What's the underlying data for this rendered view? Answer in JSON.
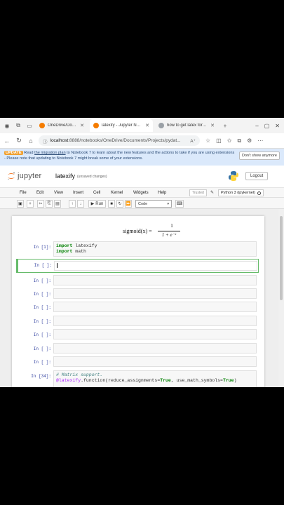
{
  "browser": {
    "tabs": [
      {
        "title": "OneDrive/Documents/P",
        "favicon_color": "#f57c00"
      },
      {
        "title": "latexify - Jupyter Notel",
        "favicon_color": "#f57c00",
        "active": true
      },
      {
        "title": "how to get latex formul",
        "favicon_color": "#5f6368"
      }
    ],
    "new_tab": "+",
    "window_controls": {
      "minimize": "–",
      "maximize": "▢",
      "close": "✕"
    },
    "address": {
      "host": "localhost",
      "rest": ":8888/notebooks/OneDrive/Documents/Projects/pydat...",
      "reader": "A",
      "zoom_label": "A⁺"
    }
  },
  "banner": {
    "badge": "UPDATE",
    "text_before": "Read ",
    "link": "the migration plan",
    "text_after": " to Notebook 7 to learn about the new features and the actions to take if you are using extensions - Please note that updating to Notebook 7 might break some of your extensions.",
    "dismiss": "Don't show anymore"
  },
  "header": {
    "logo_text": "jupyter",
    "notebook_name": "latexify",
    "save_status": "(unsaved changes)",
    "logout": "Logout"
  },
  "menu": {
    "items": [
      "File",
      "Edit",
      "View",
      "Insert",
      "Cell",
      "Kernel",
      "Widgets",
      "Help"
    ],
    "trusted": "Trusted",
    "kernel": "Python 3 (ipykernel)"
  },
  "toolbar": {
    "run_label": "Run",
    "cell_type": "Code"
  },
  "notebook": {
    "output_math": {
      "lhs": "sigmoid(x) =",
      "numerator": "1",
      "denominator": "1 + e⁻ˣ"
    },
    "cells": [
      {
        "prompt": "In [1]:",
        "lines": [
          "import latexify",
          "import math"
        ]
      },
      {
        "prompt": "In [ ]:",
        "lines": [
          ""
        ]
      },
      {
        "prompt": "In [ ]:",
        "lines": [
          ""
        ]
      },
      {
        "prompt": "In [ ]:",
        "lines": [
          ""
        ]
      },
      {
        "prompt": "In [ ]:",
        "lines": [
          ""
        ]
      },
      {
        "prompt": "In [ ]:",
        "lines": [
          ""
        ]
      },
      {
        "prompt": "In [ ]:",
        "lines": [
          ""
        ]
      },
      {
        "prompt": "In [ ]:",
        "lines": [
          ""
        ]
      },
      {
        "prompt": "In [ ]:",
        "lines": [
          ""
        ]
      },
      {
        "prompt": "In [34]:",
        "lines": [
          "# Matrix support.",
          "@latexify.function(reduce_assignments=True, use_math_symbols=True)"
        ]
      }
    ]
  }
}
